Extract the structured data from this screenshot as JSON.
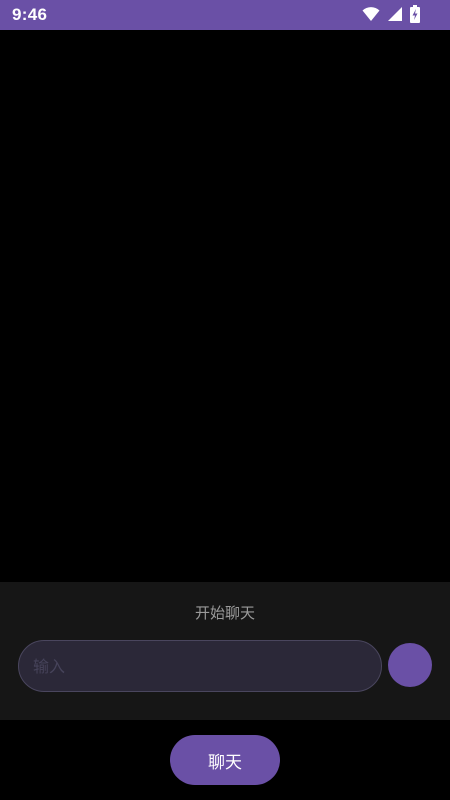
{
  "status_bar": {
    "time": "9:46",
    "icons": [
      "wifi-icon",
      "cellular-signal-icon",
      "battery-charging-icon"
    ],
    "background": "#6a50a6"
  },
  "chat_panel": {
    "hint": "开始聊天",
    "input": {
      "placeholder": "输入",
      "value": ""
    },
    "send_button": {
      "color": "#6a50a6"
    }
  },
  "bottom": {
    "chat_button_label": "聊天"
  },
  "colors": {
    "accent": "#6a50a6",
    "background": "#000000",
    "panel": "#161616",
    "input_fill": "#2b2838",
    "hint_text": "#9a9a9a"
  }
}
